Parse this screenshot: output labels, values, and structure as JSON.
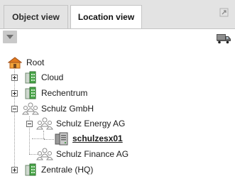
{
  "tabs": {
    "object_view": "Object view",
    "location_view": "Location view"
  },
  "tree": {
    "root": "Root",
    "cloud": "Cloud",
    "rechentrum": "Rechentrum",
    "schulz_gmbh": "Schulz GmbH",
    "schulz_energy": "Schulz Energy AG",
    "schulzesx01": "schulzesx01",
    "schulz_finance": "Schulz Finance AG",
    "zentrale": "Zentrale (HQ)"
  },
  "icons": {
    "expand": "expand-arrow-icon",
    "menu": "dropdown-menu-icon",
    "truck": "truck-icon",
    "root": "house-icon",
    "building": "building-icon",
    "organization": "organization-icon",
    "server": "server-icon"
  },
  "colors": {
    "tabbar_bg": "#e3e3e3",
    "building_green": "#3f9a3f",
    "house_orange": "#e07a1e"
  }
}
